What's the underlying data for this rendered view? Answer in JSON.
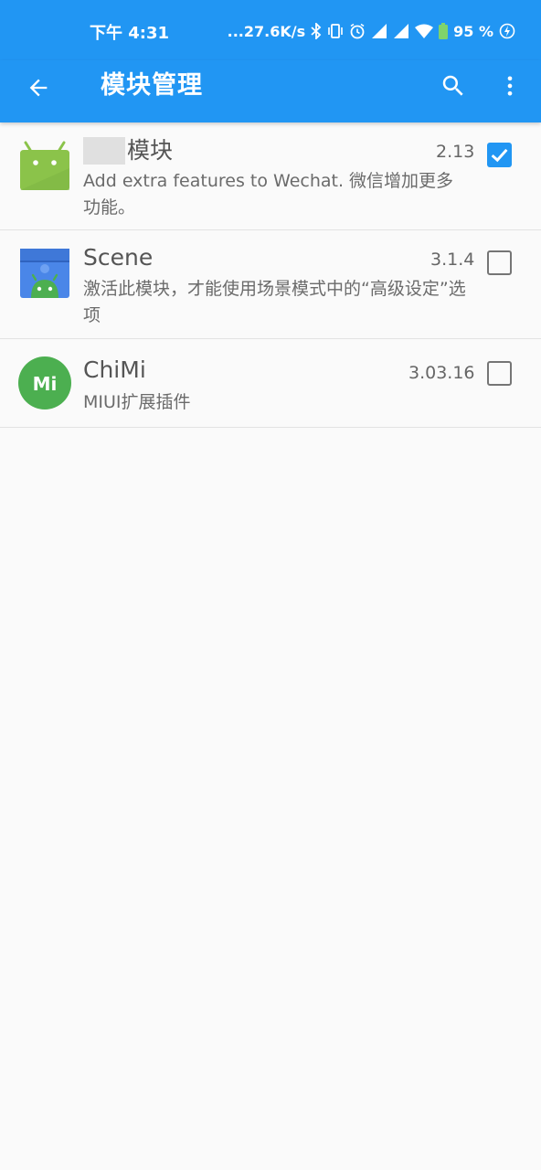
{
  "status_bar": {
    "time": "下午 4:31",
    "net_speed": "...27.6K/s",
    "battery": "95 %"
  },
  "app_bar": {
    "title": "模块管理",
    "back_icon": "arrow-left-icon",
    "search_icon": "search-icon",
    "more_icon": "more-vert-icon"
  },
  "modules": [
    {
      "name": "模块",
      "version": "2.13",
      "description": "Add extra features to Wechat. 微信增加更多功能。",
      "enabled": true,
      "icon": "android-icon"
    },
    {
      "name": "Scene",
      "version": "3.1.4",
      "description": "激活此模块，才能使用场景模式中的“高级设定”选项",
      "enabled": false,
      "icon": "scene-icon"
    },
    {
      "name": "ChiMi",
      "version": "3.03.16",
      "description": "MIUI扩展插件",
      "enabled": false,
      "icon": "chimi-icon"
    }
  ],
  "colors": {
    "primary": "#2196f3",
    "checkbox_on": "#2196f3",
    "android_green": "#8bc34a",
    "scene_blue": "#4a86e8",
    "chimi_green": "#4caf50"
  }
}
